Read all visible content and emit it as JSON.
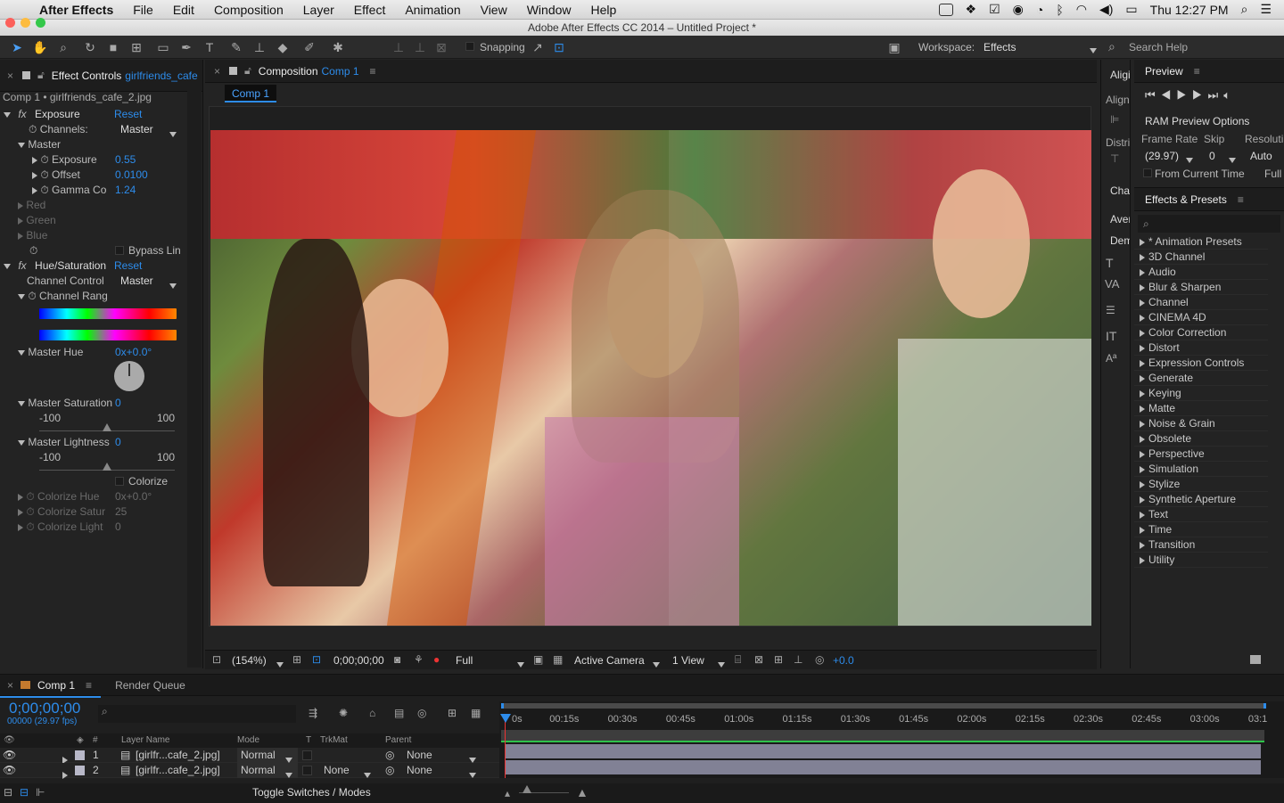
{
  "menubar": {
    "app": "After Effects",
    "items": [
      "File",
      "Edit",
      "Composition",
      "Layer",
      "Effect",
      "Animation",
      "View",
      "Window",
      "Help"
    ],
    "clock": "Thu 12:27 PM"
  },
  "window": {
    "title": "Adobe After Effects CC 2014 – Untitled Project *"
  },
  "toolbar": {
    "snapping": "Snapping",
    "workspace_label": "Workspace:",
    "workspace_value": "Effects",
    "search_help": "Search Help"
  },
  "effect_controls": {
    "tab_label": "Effect Controls",
    "tab_file": "girlfriends_cafe",
    "header": "Comp 1 • girlfriends_cafe_2.jpg",
    "exposure": {
      "name": "Exposure",
      "reset": "Reset",
      "channels_label": "Channels:",
      "channels_value": "Master",
      "master": "Master",
      "exposure_label": "Exposure",
      "exposure_value": "0.55",
      "offset_label": "Offset",
      "offset_value": "0.0100",
      "gamma_label": "Gamma Co",
      "gamma_value": "1.24",
      "red": "Red",
      "green": "Green",
      "blue": "Blue",
      "bypass": "Bypass Lin"
    },
    "hue_sat": {
      "name": "Hue/Saturation",
      "reset": "Reset",
      "channel_control_label": "Channel Control",
      "channel_control_value": "Master",
      "channel_range": "Channel Rang",
      "master_hue_label": "Master Hue",
      "master_hue_value": "0x+0.0°",
      "master_sat_label": "Master Saturation",
      "master_sat_value": "0",
      "sat_min": "-100",
      "sat_max": "100",
      "sat_level": 0.5,
      "master_light_label": "Master Lightness",
      "master_light_value": "0",
      "light_min": "-100",
      "light_max": "100",
      "light_level": 0.5,
      "colorize": "Colorize",
      "colorize_hue_label": "Colorize Hue",
      "colorize_hue_value": "0x+0.0°",
      "colorize_sat_label": "Colorize Satur",
      "colorize_sat_value": "25",
      "colorize_light_label": "Colorize Light",
      "colorize_light_value": "0"
    }
  },
  "composition": {
    "tab_label": "Composition",
    "tab_comp": "Comp 1",
    "flow_tab": "Comp 1",
    "footer": {
      "zoom": "(154%)",
      "timecode": "0;00;00;00",
      "resolution": "Full",
      "camera": "Active Camera",
      "views": "1 View",
      "exposure": "+0.0"
    }
  },
  "right_strip": {
    "align_tab": "Aligi",
    "align": "Align",
    "distri": "Distri",
    "char": "Char",
    "aver": "Aver",
    "dem": "Dem"
  },
  "preview": {
    "tab_label": "Preview",
    "ram_options": "RAM Preview Options",
    "frame_rate_label": "Frame Rate",
    "skip_label": "Skip",
    "resolution_label": "Resoluti",
    "frame_rate_value": "(29.97)",
    "skip_value": "0",
    "resolution_value": "Auto",
    "from_current": "From Current Time",
    "full": "Full"
  },
  "effects_presets": {
    "tab_label": "Effects & Presets",
    "items": [
      "* Animation Presets",
      "3D Channel",
      "Audio",
      "Blur & Sharpen",
      "Channel",
      "CINEMA 4D",
      "Color Correction",
      "Distort",
      "Expression Controls",
      "Generate",
      "Keying",
      "Matte",
      "Noise & Grain",
      "Obsolete",
      "Perspective",
      "Simulation",
      "Stylize",
      "Synthetic Aperture",
      "Text",
      "Time",
      "Transition",
      "Utility"
    ]
  },
  "timeline": {
    "tab_comp": "Comp 1",
    "tab_render": "Render Queue",
    "timecode": "0;00;00;00",
    "fps": "00000 (29.97 fps)",
    "col_num": "#",
    "col_layer": "Layer Name",
    "col_mode": "Mode",
    "col_t": "T",
    "col_trkmat": "TrkMat",
    "col_parent": "Parent",
    "ruler": [
      "0s",
      "00:15s",
      "00:30s",
      "00:45s",
      "01:00s",
      "01:15s",
      "01:30s",
      "01:45s",
      "02:00s",
      "02:15s",
      "02:30s",
      "02:45s",
      "03:00s",
      "03:1"
    ],
    "layers": [
      {
        "num": "1",
        "name": "[girlfr...cafe_2.jpg]",
        "mode": "Normal",
        "trkmat": "",
        "parent": "None"
      },
      {
        "num": "2",
        "name": "[girlfr...cafe_2.jpg]",
        "mode": "Normal",
        "trkmat": "None",
        "parent": "None"
      }
    ],
    "toggle": "Toggle Switches / Modes"
  }
}
